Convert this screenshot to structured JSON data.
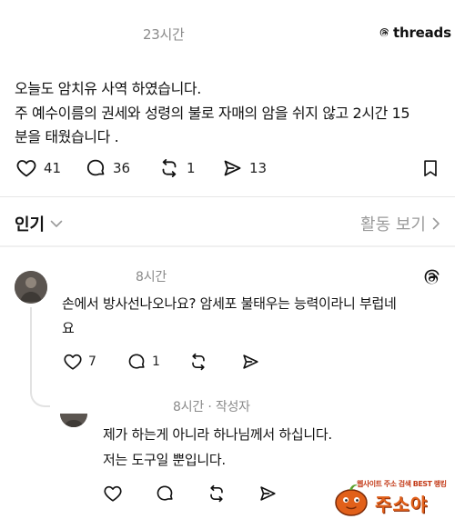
{
  "post": {
    "timestamp": "23시간",
    "brand": "threads",
    "lines": [
      "오늘도 암치유 사역 하였습니다.",
      "주 예수이름의 권세와 성령의 불로  자매의 암을 쉬지 않고 2시간 15",
      "분을 태웠습니다 ."
    ],
    "likes": "41",
    "comments": "36",
    "reposts": "1",
    "shares": "13"
  },
  "sort": {
    "label": "인기",
    "activity": "활동 보기"
  },
  "comment": {
    "timestamp": "8시간",
    "lines": [
      "손에서 방사선나오나요? 암세포 불태우는 능력이라니 부럽네",
      "요"
    ],
    "likes": "7",
    "replies": "1"
  },
  "reply": {
    "timestamp": "8시간 · 작성자",
    "lines": [
      "제가 하는게 아니라 하나님께서 하십니다.",
      "저는 도구일 뿐입니다."
    ]
  },
  "watermark": {
    "tagline": "웹사이트 주소 검색 BEST 랭킹",
    "name": "주소야"
  },
  "colors": {
    "text": "#101010",
    "muted": "#8a8a8a",
    "divider": "#e6e6e6",
    "watermark": "#e1601a"
  }
}
